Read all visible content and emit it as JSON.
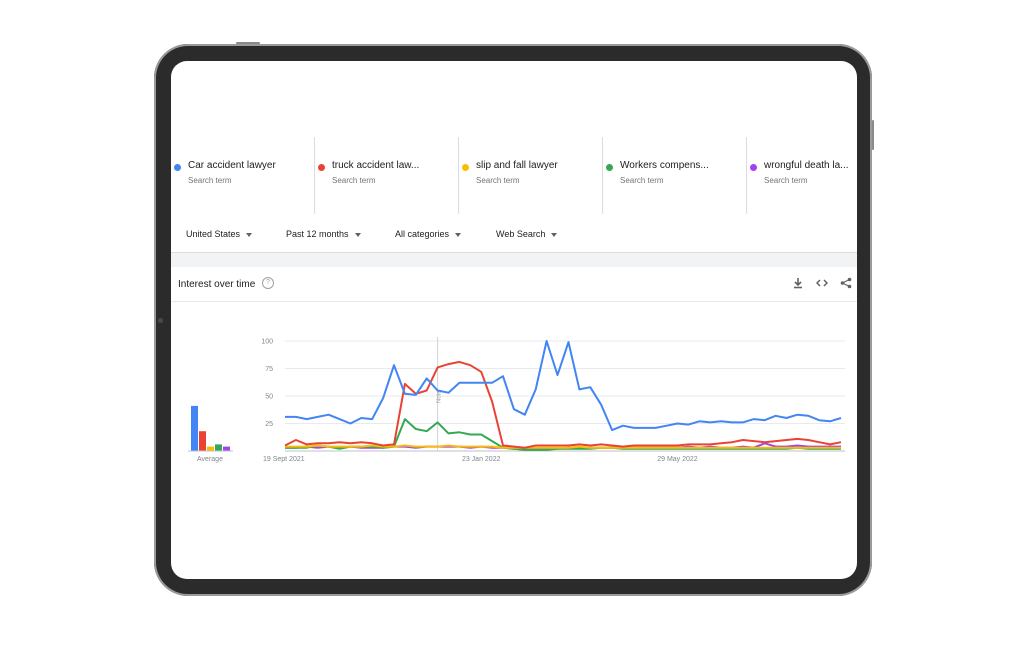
{
  "search_terms": [
    {
      "name": "Car accident lawyer",
      "type": "Search term",
      "color": "#4285f4"
    },
    {
      "name": "truck accident law...",
      "type": "Search term",
      "color": "#ea4335"
    },
    {
      "name": "slip and fall  lawyer",
      "type": "Search term",
      "color": "#fbbc04"
    },
    {
      "name": "Workers compens...",
      "type": "Search term",
      "color": "#34a853"
    },
    {
      "name": "wrongful death  la...",
      "type": "Search term",
      "color": "#a142f4"
    }
  ],
  "filters": {
    "region": "United States",
    "time": "Past 12 months",
    "category": "All categories",
    "search_type": "Web Search"
  },
  "card": {
    "title": "Interest over time",
    "help_glyph": "?",
    "icons": [
      "download-icon",
      "embed-icon",
      "share-icon"
    ]
  },
  "chart_data": {
    "type": "line",
    "ylim": [
      0,
      100
    ],
    "y_ticks": [
      "100",
      "75",
      "50",
      "25"
    ],
    "x_tick_labels": [
      "19 Sept 2021",
      "23 Jan 2022",
      "29 May 2022"
    ],
    "x_tick_index": [
      0,
      18,
      36
    ],
    "note_label": "Note",
    "note_index": 14,
    "average_label": "Average",
    "averages": [
      41,
      18,
      4,
      6,
      4
    ],
    "series": [
      {
        "name": "Car accident lawyer",
        "color": "#4285f4",
        "values": [
          31,
          31,
          29,
          31,
          33,
          29,
          25,
          30,
          29,
          48,
          78,
          52,
          51,
          66,
          55,
          53,
          62,
          62,
          62,
          62,
          68,
          38,
          33,
          56,
          100,
          69,
          99,
          56,
          58,
          42,
          19,
          23,
          21,
          21,
          21,
          23,
          25,
          24,
          27,
          26,
          27,
          26,
          26,
          29,
          28,
          32,
          30,
          33,
          32,
          28,
          27,
          30
        ]
      },
      {
        "name": "truck accident law...",
        "color": "#ea4335",
        "values": [
          5,
          10,
          6,
          7,
          7,
          8,
          7,
          8,
          7,
          5,
          6,
          61,
          52,
          55,
          76,
          79,
          81,
          78,
          72,
          45,
          5,
          4,
          3,
          5,
          5,
          5,
          5,
          6,
          5,
          6,
          5,
          4,
          5,
          5,
          5,
          5,
          5,
          6,
          6,
          6,
          7,
          8,
          10,
          9,
          8,
          9,
          10,
          11,
          10,
          8,
          6,
          8
        ]
      },
      {
        "name": "slip and fall  lawyer",
        "color": "#fbbc04",
        "values": [
          4,
          4,
          4,
          5,
          4,
          4,
          4,
          4,
          5,
          4,
          4,
          5,
          4,
          4,
          4,
          5,
          4,
          4,
          4,
          4,
          3,
          3,
          3,
          3,
          3,
          3,
          3,
          4,
          3,
          3,
          3,
          3,
          3,
          3,
          3,
          3,
          3,
          3,
          3,
          3,
          3,
          3,
          3,
          3,
          3,
          3,
          3,
          3,
          3,
          3,
          3,
          3
        ]
      },
      {
        "name": "Workers compens...",
        "color": "#34a853",
        "values": [
          3,
          3,
          3,
          5,
          4,
          2,
          4,
          4,
          4,
          3,
          4,
          29,
          20,
          18,
          26,
          16,
          17,
          15,
          15,
          9,
          3,
          2,
          1,
          1,
          1,
          2,
          2,
          2,
          2,
          3,
          3,
          2,
          2,
          2,
          2,
          2,
          2,
          2,
          2,
          2,
          2,
          2,
          2,
          2,
          2,
          2,
          2,
          3,
          2,
          2,
          2,
          2
        ]
      },
      {
        "name": "wrongful death  la...",
        "color": "#a142f4",
        "values": [
          3,
          3,
          4,
          3,
          4,
          3,
          4,
          3,
          3,
          3,
          4,
          4,
          3,
          4,
          4,
          4,
          4,
          3,
          4,
          3,
          3,
          2,
          2,
          2,
          2,
          2,
          3,
          3,
          3,
          3,
          3,
          3,
          3,
          3,
          3,
          3,
          3,
          4,
          3,
          4,
          3,
          3,
          4,
          3,
          7,
          4,
          4,
          5,
          4,
          4,
          4,
          4
        ]
      }
    ]
  }
}
